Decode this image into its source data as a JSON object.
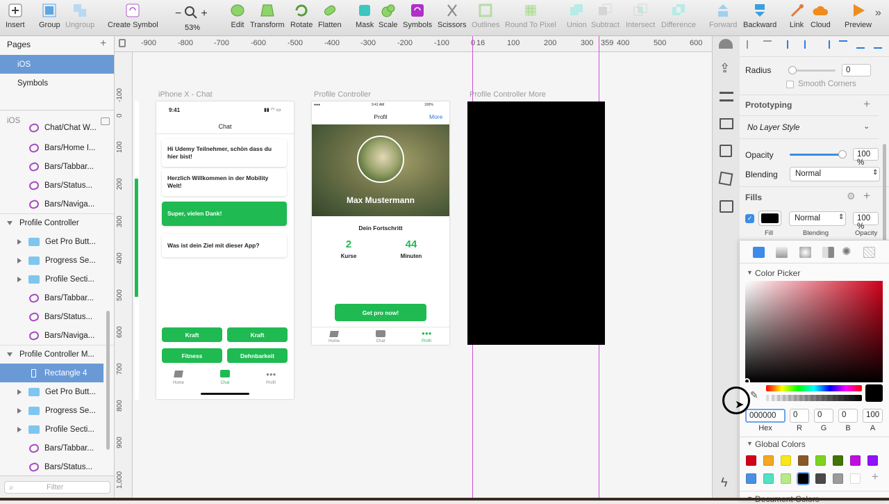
{
  "toolbar": {
    "items": [
      {
        "label": "Insert"
      },
      {
        "label": "Group"
      },
      {
        "label": "Ungroup"
      },
      {
        "label": "Create Symbol"
      },
      {
        "label": "53%"
      },
      {
        "label": "Edit"
      },
      {
        "label": "Transform"
      },
      {
        "label": "Rotate"
      },
      {
        "label": "Flatten"
      },
      {
        "label": "Mask"
      },
      {
        "label": "Scale"
      },
      {
        "label": "Symbols"
      },
      {
        "label": "Scissors"
      },
      {
        "label": "Outlines"
      },
      {
        "label": "Round To Pixel"
      },
      {
        "label": "Union"
      },
      {
        "label": "Subtract"
      },
      {
        "label": "Intersect"
      },
      {
        "label": "Difference"
      },
      {
        "label": "Forward"
      },
      {
        "label": "Backward"
      },
      {
        "label": "Link"
      },
      {
        "label": "Cloud"
      },
      {
        "label": "Preview"
      }
    ],
    "zoom_minus": "−",
    "zoom_plus": "+"
  },
  "sidebar": {
    "pages_title": "Pages",
    "pages": [
      {
        "label": "iOS"
      },
      {
        "label": "Symbols"
      }
    ],
    "layers_title": "iOS",
    "layers": [
      {
        "label": "Chat/Chat W..."
      },
      {
        "label": "Bars/Home I..."
      },
      {
        "label": "Bars/Tabbar..."
      },
      {
        "label": "Bars/Status..."
      },
      {
        "label": "Bars/Naviga..."
      },
      {
        "label": "Profile Controller"
      },
      {
        "label": "Get Pro Butt..."
      },
      {
        "label": "Progress Se..."
      },
      {
        "label": "Profile Secti..."
      },
      {
        "label": "Bars/Tabbar..."
      },
      {
        "label": "Bars/Status..."
      },
      {
        "label": "Bars/Naviga..."
      },
      {
        "label": "Profile Controller M..."
      },
      {
        "label": "Rectangle 4"
      },
      {
        "label": "Get Pro Butt..."
      },
      {
        "label": "Progress Se..."
      },
      {
        "label": "Profile Secti..."
      },
      {
        "label": "Bars/Tabbar..."
      },
      {
        "label": "Bars/Status..."
      }
    ],
    "filter_placeholder": "Filter"
  },
  "ruler": {
    "h": [
      "-900",
      "-800",
      "-700",
      "-600",
      "-500",
      "-400",
      "-300",
      "-200",
      "-100",
      "0",
      "16",
      "100",
      "200",
      "300",
      "359",
      "400",
      "500",
      "600"
    ],
    "v": [
      "-100",
      "0",
      "100",
      "200",
      "300",
      "400",
      "500",
      "600",
      "700",
      "800",
      "900",
      "1,000"
    ]
  },
  "artboards": {
    "chat": {
      "label": "iPhone X - Chat",
      "time": "9:41",
      "title": "Chat",
      "messages": [
        "Hi Udemy Teilnehmer, schön dass du hier bist!",
        "Herzlich Willkommen in der Mobility Welt!",
        "Super, vielen Dank!",
        "Was ist dein Ziel mit dieser App?"
      ],
      "buttons": [
        "Kraft",
        "Kraft",
        "Fitness",
        "Dehnbarkeit"
      ],
      "tabs": [
        "Home",
        "Chat",
        "Profil"
      ]
    },
    "profile": {
      "label": "Profile Controller",
      "status_time": "9:41 AM",
      "battery": "100%",
      "title": "Profil",
      "more": "More",
      "name": "Max Mustermann",
      "progress_title": "Dein Fortschritt",
      "stat1_value": "2",
      "stat1_label": "Kurse",
      "stat2_value": "44",
      "stat2_label": "Minuten",
      "cta": "Get pro now!",
      "tabs": [
        "Home",
        "Chat",
        "Profil"
      ]
    },
    "more": {
      "label": "Profile Controller More"
    }
  },
  "inspector": {
    "radius_label": "Radius",
    "radius_value": "0",
    "smooth_corners": "Smooth Corners",
    "prototyping": "Prototyping",
    "layer_style": "No Layer Style",
    "opacity_label": "Opacity",
    "opacity_value": "100 %",
    "opacity_level": 1.0,
    "blending_label": "Blending",
    "blending_value": "Normal",
    "fills_title": "Fills",
    "fill_blending": "Normal",
    "fill_opacity": "100 %",
    "fill_col_labels": [
      "Fill",
      "Blending",
      "Opacity"
    ],
    "fill_color": "#000000"
  },
  "color_picker": {
    "title": "Color Picker",
    "hex": "000000",
    "r": "0",
    "g": "0",
    "b": "0",
    "a": "100",
    "labels": [
      "Hex",
      "R",
      "G",
      "B",
      "A"
    ],
    "global_colors_title": "Global Colors",
    "document_colors_title": "Document Colors",
    "global_colors": [
      "#d0021b",
      "#f5a623",
      "#f8e71c",
      "#8b572a",
      "#7ed321",
      "#417505",
      "#bd10e0",
      "#9013fe",
      "#4a90e2",
      "#50e3c2",
      "#b8e986",
      "#000000",
      "#4a4a4a",
      "#9b9b9b",
      "#ffffff"
    ],
    "accent": "#1fba52"
  }
}
